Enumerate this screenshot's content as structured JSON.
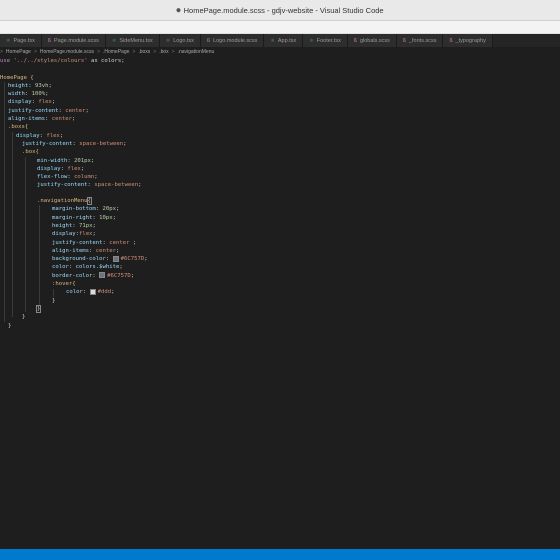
{
  "window": {
    "title": "HomePage.module.scss - gdjv-website - Visual Studio Code",
    "dirty_marker": "●"
  },
  "tabs": [
    {
      "label": "Page.tsx",
      "icon": "tsx"
    },
    {
      "label": "Page.module.scss",
      "icon": "scss"
    },
    {
      "label": "SideMenu.tsx",
      "icon": "tsx"
    },
    {
      "label": "Logo.tsx",
      "icon": "tsx"
    },
    {
      "label": "Logo.module.scss",
      "icon": "scss"
    },
    {
      "label": "App.tsx",
      "icon": "tsx"
    },
    {
      "label": "Footer.tsx",
      "icon": "tsx"
    },
    {
      "label": "globals.scss",
      "icon": "scss"
    },
    {
      "label": "_fonts.scss",
      "icon": "scss"
    },
    {
      "label": "_typography",
      "icon": "scss"
    }
  ],
  "breadcrumb": [
    ">",
    "HomePage",
    ">",
    "HomePage.module.scss",
    ">",
    ".HomePage",
    ">",
    ".boxs",
    ">",
    ".box",
    ">",
    ".navigationMenu"
  ],
  "code": {
    "l1a": "use ",
    "l1b": "'../../styles/colours'",
    "l1c": " as colors;",
    "l3": "HomePage {",
    "l4a": "height",
    "l4b": ": ",
    "l4c": "93vh",
    "l4d": ";",
    "l5a": "width",
    "l5c": "100%",
    "l6a": "display",
    "l6c": "flex",
    "l7a": "justify-content",
    "l7c": "center",
    "l8a": "align-items",
    "l8c": "center",
    "l9": ".boxs{",
    "l10a": "display",
    "l10c": "flex",
    "l11a": "justify-content",
    "l11c": "space-between",
    "l12": ".box{",
    "l13a": "min-width",
    "l13c": "201px",
    "l14a": "display",
    "l14c": "flex",
    "l15a": "flex-flow",
    "l15c": "column",
    "l16a": "justify-content",
    "l16c": "space-between",
    "l18": ".navigationMenu",
    "l18b": "{",
    "l19a": "margin-bottom",
    "l19c": "20px",
    "l20a": "margin-right",
    "l20c": "10px",
    "l21a": "height",
    "l21c": "71px",
    "l22a": "display",
    "l22b": ":",
    "l22c": "flex",
    "l23a": "justify-content",
    "l23c": "center ",
    "l24a": "align-items",
    "l24c": "center",
    "l25a": "background-color",
    "l25c": "#6C757D",
    "l26a": "color",
    "l26c": "colors.$white",
    "l27a": "border-color",
    "l27c": "#6C757D",
    "l28": ":hover{",
    "l29a": "color",
    "l29c": "#ddd",
    "close": "}"
  },
  "colors": {
    "swatch_grey": "#6C757D",
    "swatch_light": "#dddddd",
    "status_bar": "#007acc"
  }
}
